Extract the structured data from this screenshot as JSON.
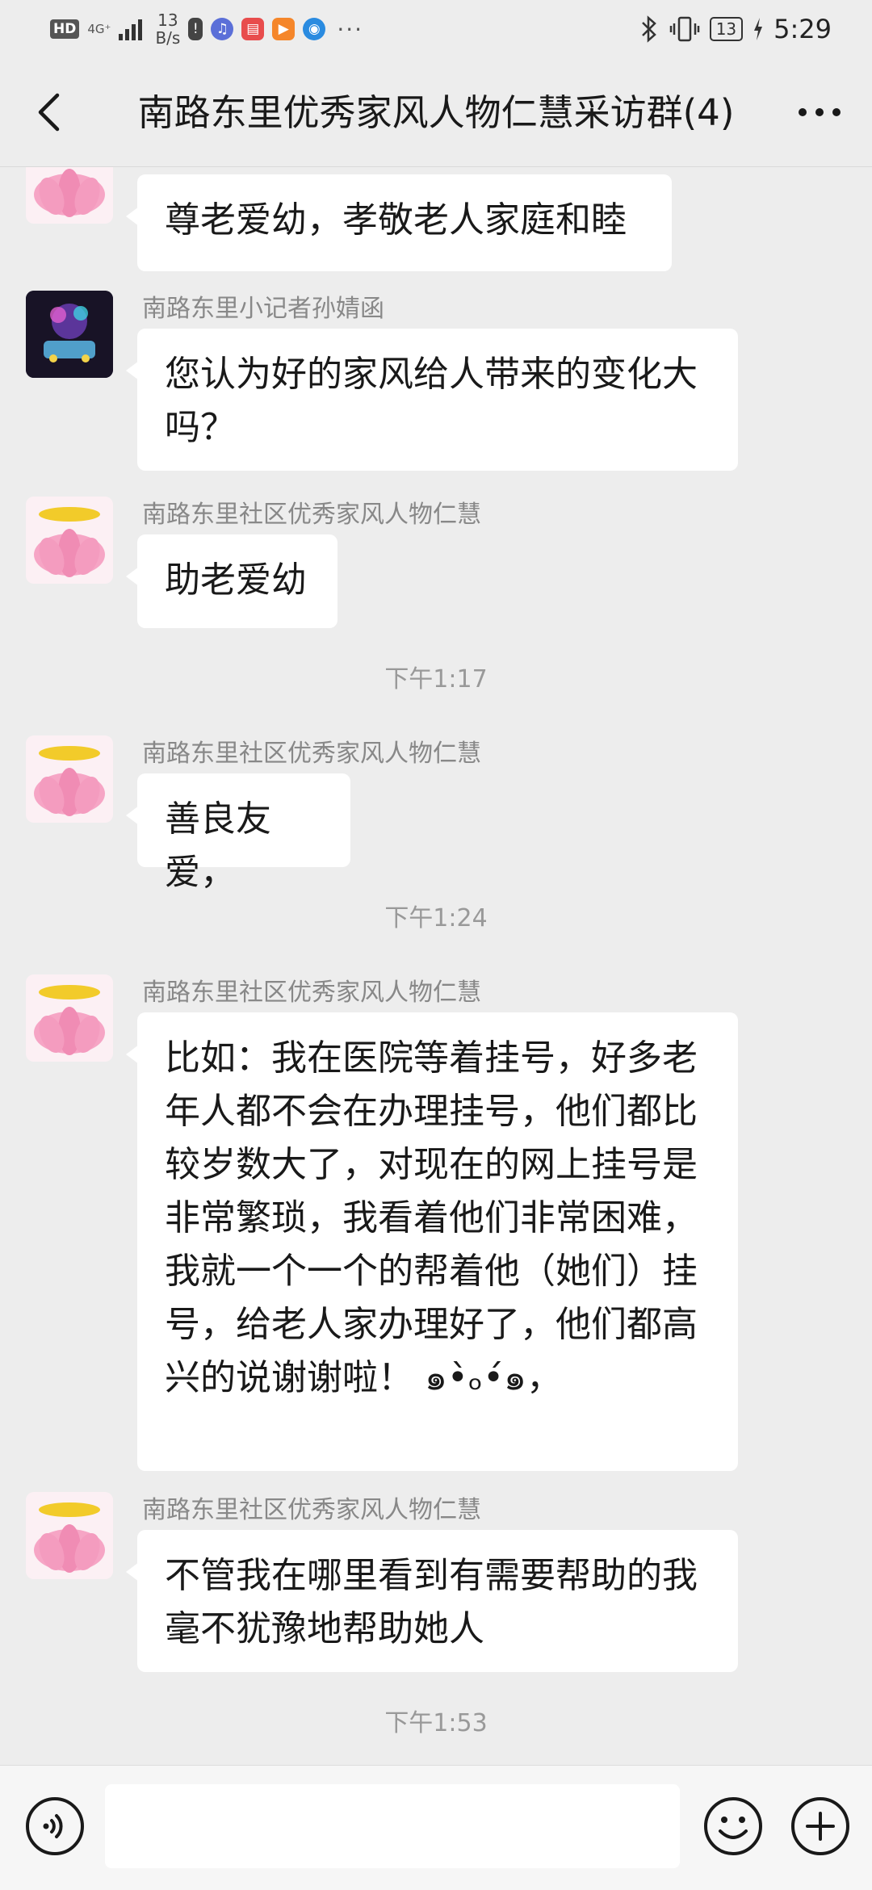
{
  "status_bar": {
    "hd": "HD",
    "network": "4G⁺",
    "speed_value": "13",
    "speed_unit": "B/s",
    "battery": "13",
    "time": "5:29"
  },
  "header": {
    "title": "南路东里优秀家风人物仁慧采访群(4)"
  },
  "messages": [
    {
      "sender": "",
      "text": "尊老爱幼，孝敬老人家庭和睦"
    },
    {
      "sender": "南路东里小记者孙婧函",
      "text": "您认为好的家风给人带来的变化大吗？"
    },
    {
      "sender": "南路东里社区优秀家风人物仁慧",
      "text": "助老爱幼"
    },
    {
      "sender": "南路东里社区优秀家风人物仁慧",
      "text": "善良友爱，"
    },
    {
      "sender": "南路东里社区优秀家风人物仁慧",
      "text": "比如：我在医院等着挂号，好多老年人都不会在办理挂号，他们都比较岁数大了，对现在的网上挂号是非常繁琐，我看着他们非常困难，我就一个一个的帮着他（她们）挂号，给老人家办理好了，他们都高兴的说谢谢啦！ ๑•̀ₒ•́๑，"
    },
    {
      "sender": "南路东里社区优秀家风人物仁慧",
      "text": "不管我在哪里看到有需要帮助的我毫不犹豫地帮助她人"
    }
  ],
  "timestamps": [
    "下午1:17",
    "下午1:24",
    "下午1:53"
  ],
  "input": {
    "placeholder": ""
  },
  "colors": {
    "background": "#ededed",
    "bubble": "#ffffff",
    "lotus": "#f08cb4"
  }
}
